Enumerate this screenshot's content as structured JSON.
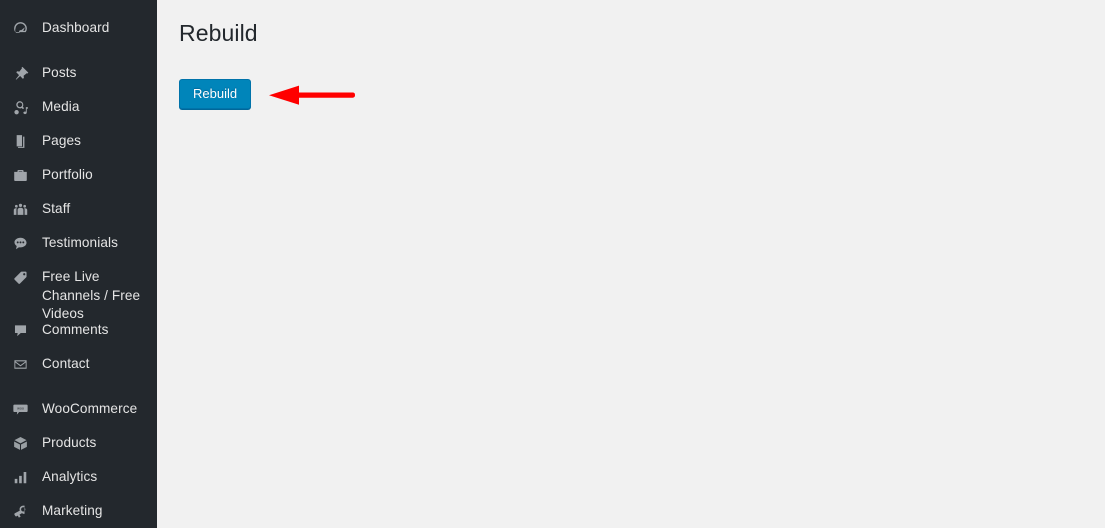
{
  "app": {
    "content_background": "#f1f1f1",
    "sidebar_background": "#23282d",
    "accent_button_color": "#0085ba",
    "annotation_color": "#ff0000"
  },
  "sidebar": {
    "items": [
      {
        "label": "Dashboard",
        "icon": "dashboard-icon",
        "two_line": false
      },
      {
        "label": "Posts",
        "icon": "pin-icon",
        "two_line": false
      },
      {
        "label": "Media",
        "icon": "media-icon",
        "two_line": false
      },
      {
        "label": "Pages",
        "icon": "pages-icon",
        "two_line": false
      },
      {
        "label": "Portfolio",
        "icon": "portfolio-icon",
        "two_line": false
      },
      {
        "label": "Staff",
        "icon": "staff-group-icon",
        "two_line": false
      },
      {
        "label": "Testimonials",
        "icon": "speech-bubble-icon",
        "two_line": false
      },
      {
        "label": "Free Live Channels / Free Videos",
        "icon": "tag-icon",
        "two_line": true
      },
      {
        "label": "Comments",
        "icon": "comment-icon",
        "two_line": false
      },
      {
        "label": "Contact",
        "icon": "envelope-icon",
        "two_line": false
      },
      {
        "label": "WooCommerce",
        "icon": "woocommerce-icon",
        "two_line": false
      },
      {
        "label": "Products",
        "icon": "products-box-icon",
        "two_line": false
      },
      {
        "label": "Analytics",
        "icon": "analytics-bars-icon",
        "two_line": false
      },
      {
        "label": "Marketing",
        "icon": "megaphone-icon",
        "two_line": false
      }
    ]
  },
  "main": {
    "page_title": "Rebuild",
    "rebuild_button_label": "Rebuild"
  }
}
